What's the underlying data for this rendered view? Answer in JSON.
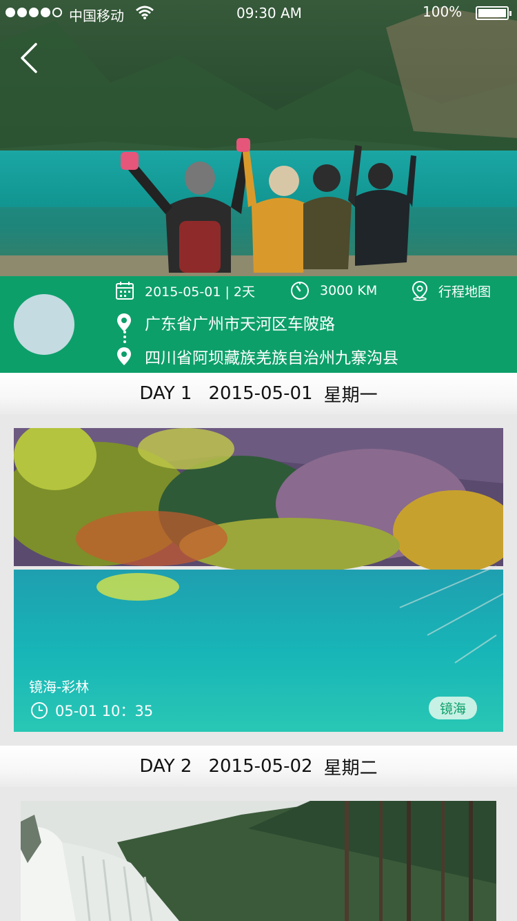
{
  "status_bar": {
    "carrier": "中国移动",
    "time": "09:30 AM",
    "battery": "100%"
  },
  "trip": {
    "date_duration": "2015-05-01 | 2天",
    "distance": "3000 KM",
    "map_label": "行程地图",
    "start": "广东省广州市天河区车陂路",
    "end": "四川省阿坝藏族羌族自治州九寨沟县"
  },
  "days": [
    {
      "day": "DAY 1",
      "date": "2015-05-01",
      "weekday": "星期一",
      "photo": {
        "title": "镜海-彩林",
        "time": "05-01  10：35",
        "tag": "镜海"
      }
    },
    {
      "day": "DAY 2",
      "date": "2015-05-02",
      "weekday": "星期二"
    }
  ],
  "colors": {
    "brand_green": "#0d9f6a",
    "tag_bg": "#c7f1e4",
    "avatar_bg": "#c4dbe1"
  },
  "icons": [
    "back-arrow-icon",
    "wifi-icon",
    "calendar-icon",
    "speedometer-icon",
    "map-pin-icon",
    "location-pin-icon",
    "clock-icon"
  ]
}
